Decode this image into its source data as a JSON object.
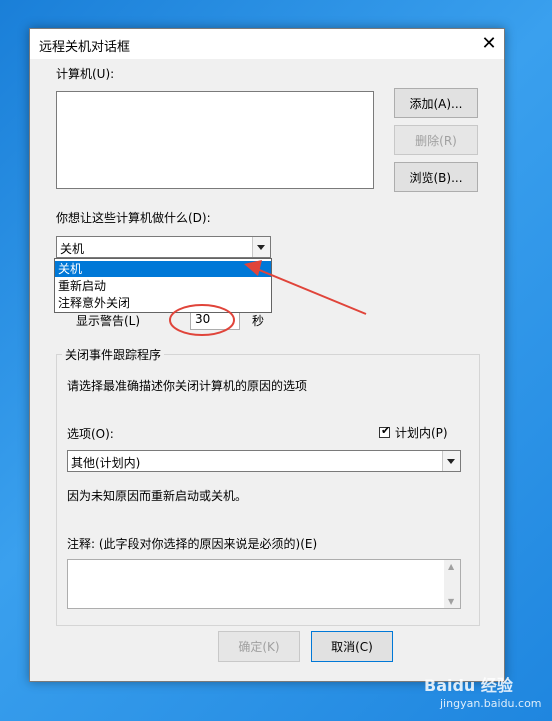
{
  "dialog": {
    "title": "远程关机对话框",
    "computers_label": "计算机(U):",
    "add_button": "添加(A)...",
    "delete_button": "删除(R)",
    "browse_button": "浏览(B)...",
    "action_question": "你想让这些计算机做什么(D):",
    "action_selected": "关机",
    "action_options": [
      "关机",
      "重新启动",
      "注释意外关闭"
    ],
    "warning_label": "显示警告(L)",
    "warning_value": "30",
    "warning_unit": "秒",
    "tracker": {
      "title": "关闭事件跟踪程序",
      "instruction": "请选择最准确描述你关闭计算机的原因的选项",
      "option_label": "选项(O):",
      "planned_label": "计划内(P)",
      "planned_checked": true,
      "option_value": "其他(计划内)",
      "option_description": "因为未知原因而重新启动或关机。",
      "comment_label": "注释: (此字段对你选择的原因来说是必须的)(E)"
    },
    "ok_button": "确定(K)",
    "cancel_button": "取消(C)"
  },
  "watermark": {
    "brand": "Baidu 经验",
    "url": "jingyan.baidu.com"
  },
  "colors": {
    "selection": "#0078d7",
    "annotation_red": "#e0443a",
    "desktop_blue": "#1f86df"
  }
}
